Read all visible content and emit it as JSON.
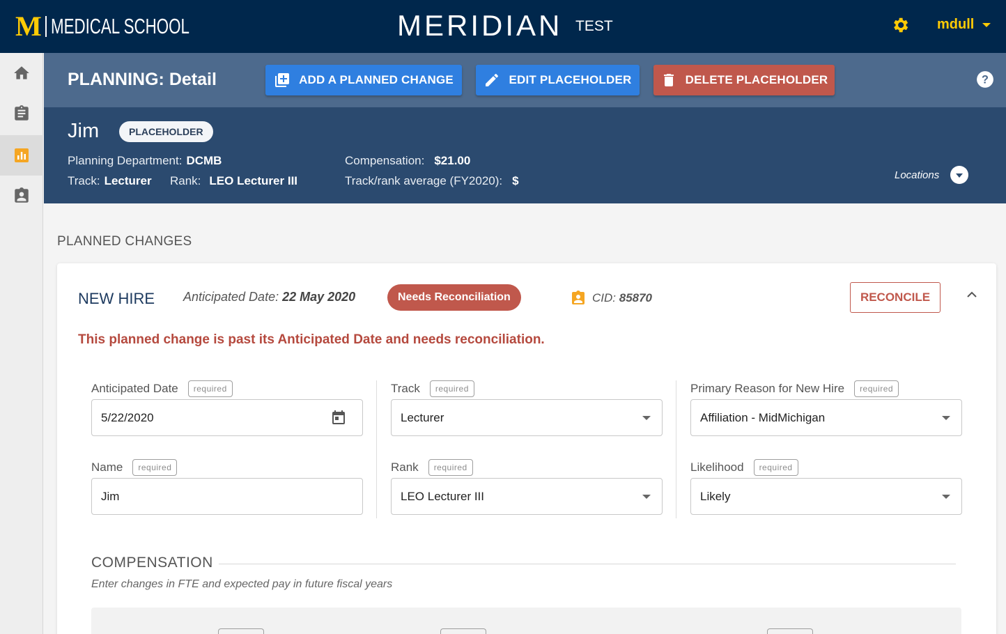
{
  "brand": {
    "mark": "M",
    "text": "MEDICAL SCHOOL"
  },
  "app": {
    "title": "MERIDIAN",
    "env": "TEST"
  },
  "user": {
    "name": "mdull"
  },
  "colors": {
    "navy": "#00274c",
    "maize": "#ffcb05",
    "header_blue": "#4d6a8d",
    "person_band": "#2b4a6f",
    "primary": "#2f7fe0",
    "danger": "#c0584c"
  },
  "nav": [
    {
      "icon": "home-icon"
    },
    {
      "icon": "clipboard-icon"
    },
    {
      "icon": "bar-chart-icon",
      "active": true
    },
    {
      "icon": "badge-icon"
    }
  ],
  "header": {
    "title": "PLANNING: Detail",
    "add_label": "ADD A PLANNED CHANGE",
    "edit_label": "EDIT PLACEHOLDER",
    "delete_label": "DELETE PLACEHOLDER"
  },
  "person": {
    "name": "Jim",
    "tag": "PLACEHOLDER",
    "dept_label": "Planning Department:",
    "dept_value": "DCMB",
    "track_label": "Track:",
    "track_value": "Lecturer",
    "rank_label": "Rank:",
    "rank_value": "LEO Lecturer III",
    "comp_label": "Compensation:",
    "comp_value": "$21.00",
    "avg_label": "Track/rank average (FY2020):",
    "avg_value": "$",
    "locations_label": "Locations"
  },
  "planned": {
    "section_title": "PLANNED CHANGES",
    "type": "NEW HIRE",
    "date_label": "Anticipated Date:",
    "date_value": "22 May 2020",
    "status": "Needs Reconciliation",
    "cid_label": "CID:",
    "cid_value": "85870",
    "reconcile_label": "RECONCILE",
    "alert": "This planned change is past its Anticipated Date and needs reconciliation."
  },
  "form": {
    "required_tag": "required",
    "anticipated_date": {
      "label": "Anticipated Date",
      "value": "5/22/2020"
    },
    "name": {
      "label": "Name",
      "value": "Jim"
    },
    "track": {
      "label": "Track",
      "value": "Lecturer"
    },
    "rank": {
      "label": "Rank",
      "value": "LEO Lecturer III"
    },
    "reason": {
      "label": "Primary Reason for New Hire",
      "value": "Affiliation - MidMichigan"
    },
    "likelihood": {
      "label": "Likelihood",
      "value": "Likely"
    }
  },
  "compensation": {
    "title": "COMPENSATION",
    "subtitle": "Enter changes in FTE and expected pay in future fiscal years"
  }
}
